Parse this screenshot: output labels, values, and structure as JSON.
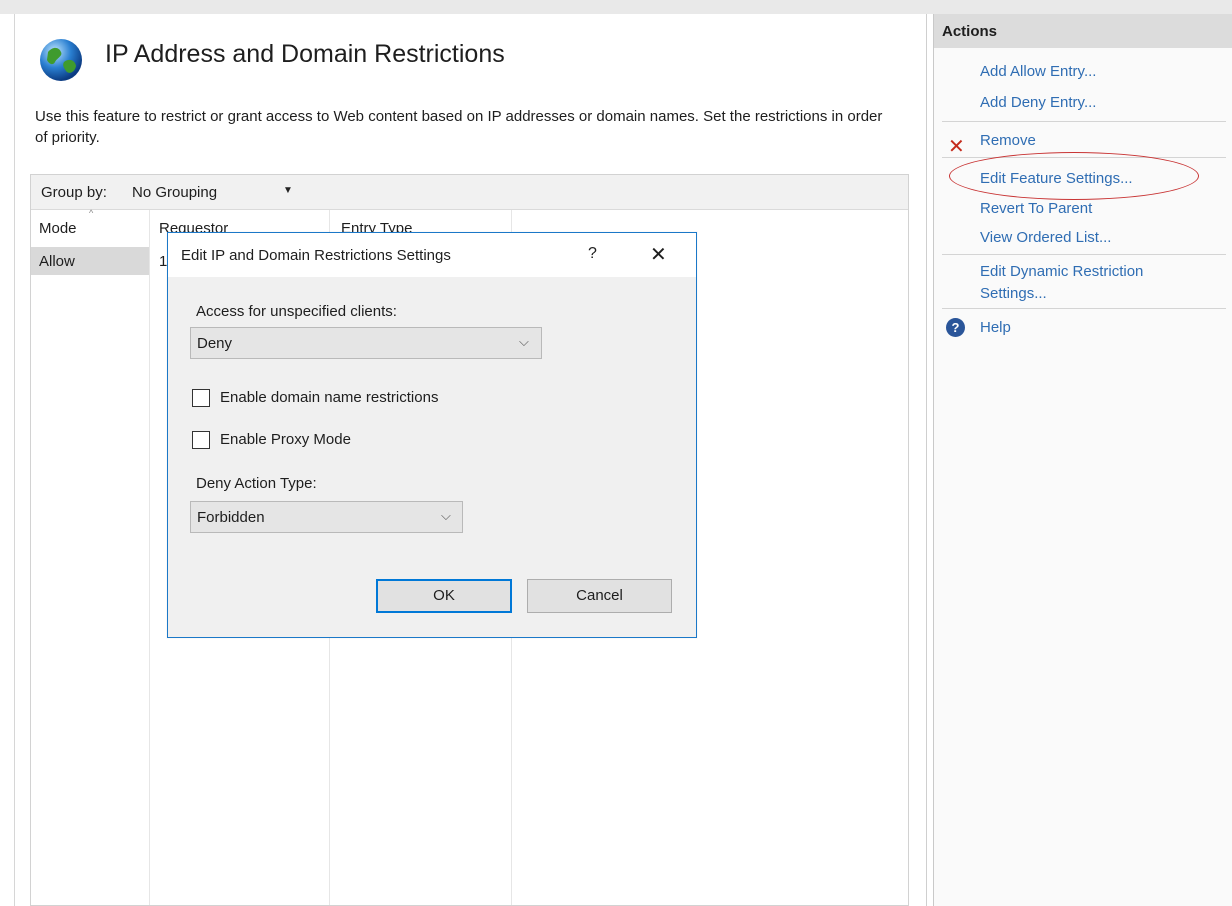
{
  "feature": {
    "title": "IP Address and Domain Restrictions",
    "description": "Use this feature to restrict or grant access to Web content based on IP addresses or domain names. Set the restrictions in order of priority."
  },
  "grid": {
    "group_by_label": "Group by:",
    "group_by_value": "No Grouping",
    "columns": [
      "Mode",
      "Requestor",
      "Entry Type"
    ],
    "rows": [
      {
        "mode": "Allow",
        "requestor": "1"
      }
    ]
  },
  "dialog": {
    "title": "Edit IP and Domain Restrictions Settings",
    "help": "?",
    "close": "✕",
    "access_label": "Access for unspecified clients:",
    "access_value": "Deny",
    "chk_domain": "Enable domain name restrictions",
    "chk_proxy": "Enable Proxy Mode",
    "deny_label": "Deny Action Type:",
    "deny_value": "Forbidden",
    "ok": "OK",
    "cancel": "Cancel"
  },
  "actions": {
    "header": "Actions",
    "add_allow": "Add Allow Entry...",
    "add_deny": "Add Deny Entry...",
    "remove": "Remove",
    "edit_feature": "Edit Feature Settings...",
    "revert": "Revert To Parent",
    "view_ordered": "View Ordered List...",
    "edit_dynamic_1": "Edit Dynamic Restriction",
    "edit_dynamic_2": "Settings...",
    "help": "Help"
  },
  "colors": {
    "accent": "#0078d7",
    "link": "#2f6db3",
    "remove_icon": "#c42b1c",
    "annotation_oval": "#c83434"
  },
  "icons": [
    "globe-icon",
    "sort-ascending-icon",
    "dropdown-caret-icon",
    "help-question-icon",
    "close-icon",
    "chevron-down-icon",
    "remove-x-icon",
    "help-circle-icon"
  ]
}
